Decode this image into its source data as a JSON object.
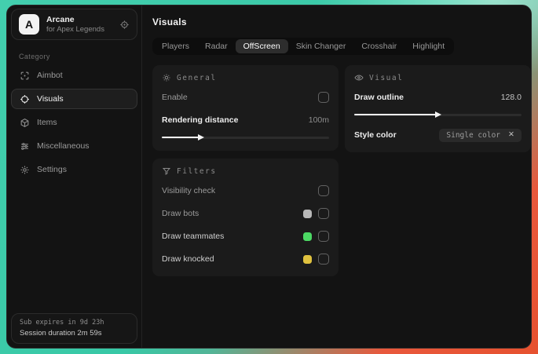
{
  "app": {
    "logo_letter": "A",
    "name": "Arcane",
    "subtitle": "for Apex Legends"
  },
  "sidebar": {
    "category_label": "Category",
    "items": [
      {
        "label": "Aimbot"
      },
      {
        "label": "Visuals"
      },
      {
        "label": "Items"
      },
      {
        "label": "Miscellaneous"
      },
      {
        "label": "Settings"
      }
    ],
    "footer": {
      "line1": "Sub expires in 9d 23h",
      "line2": "Session duration 2m 59s"
    }
  },
  "main": {
    "title": "Visuals",
    "tabs": [
      {
        "label": "Players"
      },
      {
        "label": "Radar"
      },
      {
        "label": "OffScreen"
      },
      {
        "label": "Skin Changer"
      },
      {
        "label": "Crosshair"
      },
      {
        "label": "Highlight"
      }
    ],
    "active_tab": "OffScreen"
  },
  "panels": {
    "general": {
      "title": "General",
      "enable_label": "Enable",
      "enable_checked": false,
      "rendering_label": "Rendering distance",
      "rendering_value": "100m",
      "rendering_fill": "22%"
    },
    "visual": {
      "title": "Visual",
      "outline_label": "Draw outline",
      "outline_value": "128.0",
      "outline_fill": "49%",
      "style_label": "Style color",
      "style_chip": "Single color",
      "chip_close": "✕"
    },
    "filters": {
      "title": "Filters",
      "rows": [
        {
          "label": "Visibility check",
          "checked": false
        },
        {
          "label": "Draw bots",
          "swatch": "#b8b8b8",
          "checked": false
        },
        {
          "label": "Draw teammates",
          "swatch": "#4cd964",
          "checked": false
        },
        {
          "label": "Draw knocked",
          "swatch": "#e0c23f",
          "checked": false
        }
      ]
    }
  },
  "colors": {
    "backdrop_teal": "#3ecfab",
    "backdrop_red": "#e8583c"
  }
}
